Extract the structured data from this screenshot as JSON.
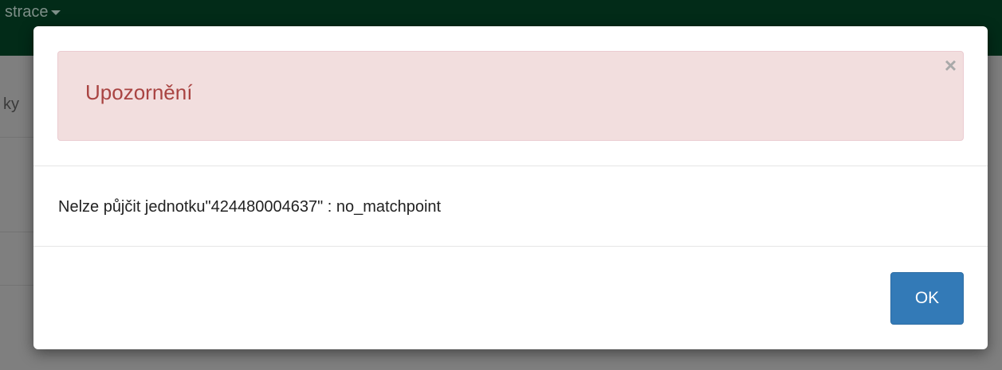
{
  "background": {
    "nav_item_fragment": "strace",
    "content_fragment": "ky"
  },
  "dialog": {
    "alert_title": "Upozornění",
    "close_symbol": "×",
    "message": "Nelze půjčit jednotku\"424480004637\" : no_matchpoint",
    "ok_label": "OK"
  },
  "colors": {
    "navbar": "#022b18",
    "alert_background": "#f2dede",
    "alert_text": "#a94442",
    "primary_button": "#337ab7"
  },
  "icons": [
    "caret-down-icon",
    "close-icon"
  ]
}
